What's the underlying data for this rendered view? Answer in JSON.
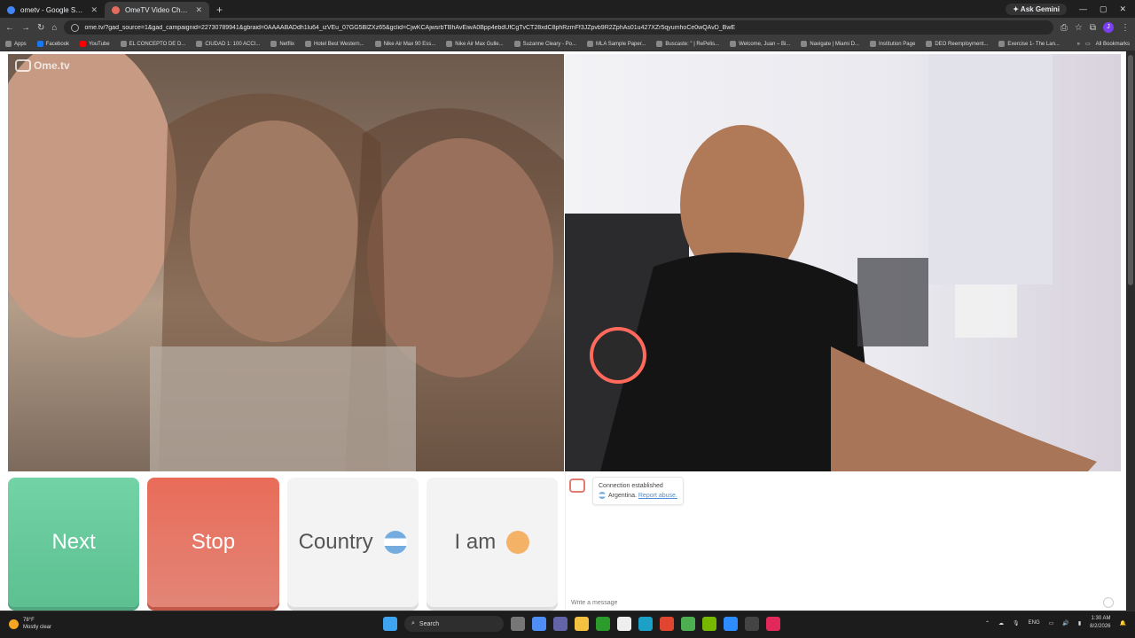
{
  "browser": {
    "tabs": [
      {
        "title": "ometv - Google Search",
        "fav_color": "#4285f4",
        "active": false
      },
      {
        "title": "OmeTV Video Chat — Ome",
        "fav_color": "#e36c5e",
        "active": true
      }
    ],
    "new_tab": "+",
    "ask_gemini": "Ask Gemini",
    "url": "ome.tv/?gad_source=1&gad_campaignid=22730789941&gbraid=0AAAABADdh1lu64_izVEu_07GG5BlZXz65&gclid=CjwKCAjwsrbTBhAvEiwA0Bpp4ebdUfCgTvCT28xdC8phRzmFf3JZpvb9R2ZphAs01u427XZr5qyumhoCe0wQAvD_BwE",
    "profile_initial": "J"
  },
  "bookmarks": {
    "items": [
      "Apps",
      "Facebook",
      "YouTube",
      "EL CONCEPTO DE D...",
      "CIUDAD 1: 100 ACCI...",
      "Netflix",
      "Hotel Best Western...",
      "Nike Air Max 90 Ess...",
      "Nike Air Max Gulle...",
      "Suzanne Cleary - Po...",
      "MLA Sample Paper...",
      "Buscaste: \" | RePelis...",
      "Welcome, Juan – Bi...",
      "Navigate | Miami D...",
      "Institution Page",
      "DEO Reemployment...",
      "Exercise 1- The Lan..."
    ],
    "all_bookmarks": "All Bookmarks"
  },
  "app": {
    "logo": "Ome.tv",
    "buttons": {
      "next": "Next",
      "stop": "Stop",
      "country": "Country",
      "iam": "I am"
    },
    "chat": {
      "status": "Connection established",
      "country": "Argentina.",
      "report": "Report abuse.",
      "placeholder": "Write a message"
    }
  },
  "taskbar": {
    "temp": "78°F",
    "weather": "Mostly clear",
    "search": "Search",
    "lang": "ENG",
    "time": "1:30 AM",
    "date": "8/2/2026"
  },
  "colors": {
    "next": "#6fd1a3",
    "stop": "#e8735f",
    "accent": "#e07b72"
  }
}
